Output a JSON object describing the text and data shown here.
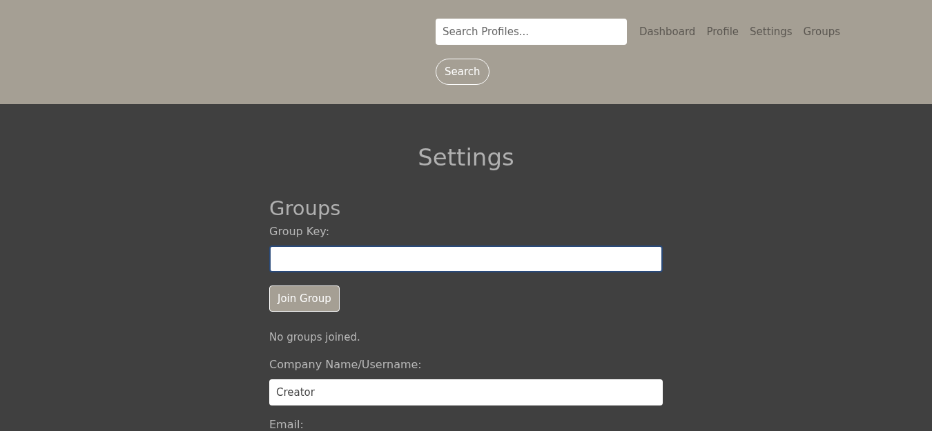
{
  "header": {
    "search": {
      "placeholder": "Search Profiles..."
    },
    "nav": [
      {
        "label": "Dashboard"
      },
      {
        "label": "Profile"
      },
      {
        "label": "Settings"
      },
      {
        "label": "Groups"
      }
    ],
    "search_button": "Search"
  },
  "page_title": "Settings",
  "groups": {
    "heading": "Groups",
    "label": "Group Key:",
    "field": {
      "focused": true
    },
    "button": "Join Group",
    "status": "No groups joined."
  },
  "fields": [
    {
      "label": "Company Name/Username:",
      "value": "Creator"
    },
    {
      "label": "Email:"
    }
  ]
}
